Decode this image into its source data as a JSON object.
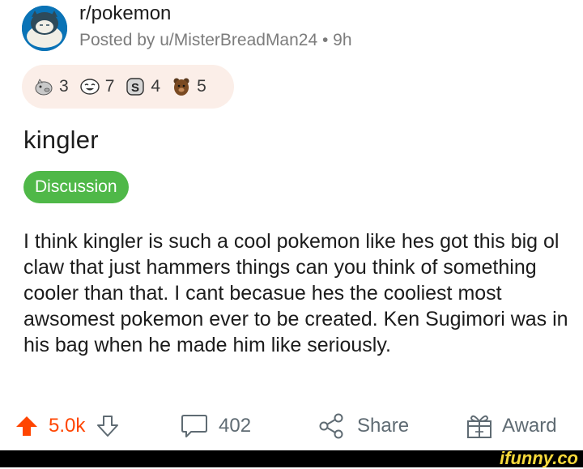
{
  "post": {
    "subreddit": "r/pokemon",
    "posted_by": "Posted by u/MisterBreadMan24 • 9h",
    "awards": [
      {
        "icon": "silver-pig-icon",
        "count": "3"
      },
      {
        "icon": "laughing-face-icon",
        "count": "7"
      },
      {
        "icon": "coin-s-icon",
        "count": "4"
      },
      {
        "icon": "bear-icon",
        "count": "5"
      }
    ],
    "title": "kingler",
    "flair": "Discussion",
    "body": "I think kingler is such a cool pokemon like hes got this big ol claw that just hammers things can you think of something cooler than that. I cant becasue hes the cooliest most awsomest pokemon ever to be created. Ken Sugimori was in his bag when he made him like seriously."
  },
  "actions": {
    "votes": "5.0k",
    "comments": "402",
    "share": "Share",
    "award": "Award"
  },
  "watermark": "ifunny.co",
  "colors": {
    "upvote": "#ff4500",
    "flair_bg": "#4fb848",
    "awards_bg": "#fbeee8",
    "muted": "#7c7c7c",
    "watermark": "#f7d93b"
  }
}
